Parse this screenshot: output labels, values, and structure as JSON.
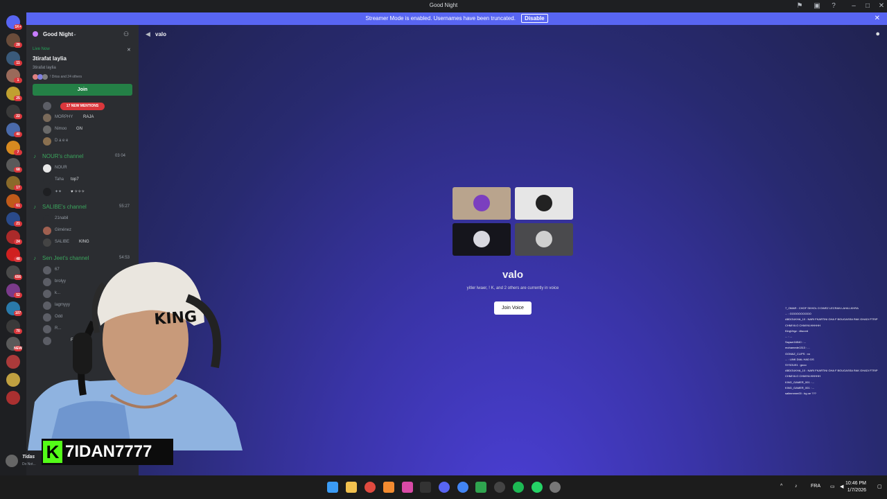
{
  "window": {
    "title": "Good Night"
  },
  "banner": {
    "text": "Streamer Mode is enabled. Usernames have been truncated.",
    "disable_label": "Disable"
  },
  "guilds": {
    "badges": [
      "1K+",
      "28",
      "11",
      "1",
      "25",
      "22",
      "40",
      "7",
      "68",
      "17",
      "61",
      "21",
      "24",
      "48",
      "656",
      "52",
      "107",
      "70",
      "NEW"
    ]
  },
  "server": {
    "name": "Good Night",
    "live": {
      "status": "Live Now",
      "title": "3tirafat laylia",
      "subtitle": "3tirafat laylia",
      "watchers": "! Driss and 24 others",
      "join_label": "Join"
    },
    "mentions_pill": "17 NEW MENTIONS",
    "top_members": [
      {
        "name": "MORPHY",
        "tag": "RAJA"
      },
      {
        "name": "Nimoo",
        "tag": "GN"
      },
      {
        "name": "D a e e",
        "tag": ""
      }
    ],
    "voice_channels": [
      {
        "name": "NOUR's channel",
        "meta": "03 04",
        "members": [
          {
            "name": "NOUR"
          },
          {
            "name": "Taha",
            "tag": "top7"
          },
          {
            "name": "✦✦",
            "tag": "♥ ✧✧✧"
          }
        ]
      },
      {
        "name": "SALIBE's channel",
        "meta": "55:27",
        "members": [
          {
            "name": "21nabil"
          },
          {
            "name": "Giménez"
          },
          {
            "name": "SALIBE",
            "tag": "KING"
          }
        ]
      },
      {
        "name": "Sen Jeet's channel",
        "meta": "54:53",
        "members": [
          {
            "name": "67"
          },
          {
            "name": "brolyy"
          },
          {
            "name": "k..."
          },
          {
            "name": "lagmyyy"
          },
          {
            "name": "Odd"
          },
          {
            "name": "R..."
          },
          {
            "name": "F1"
          }
        ]
      }
    ],
    "user": {
      "name": "Tidas",
      "status": "Do Not..."
    }
  },
  "channel": {
    "name": "valo",
    "stage_title": "valo",
    "stage_sub": "yitler lwaer, ! K, and 2 others are currently in voice",
    "join_voice_label": "Join Voice"
  },
  "stream_chat": [
    "7_OMAR : CHOF SKHOL O DWEZ LECRAN LAHA LKHRA",
    "... : GOOOOOOOOO",
    "ABDOUKHA_10 : NARI FKARTINI GHA F BOUGASSA RAK GHADI FTRIP",
    "CHMIYA O CHMIYA HHHHH",
    "KingVegz : discord",
    "... : ...",
    "Sayazr16540 : ...",
    "mohamede1313 : ...",
    "GOMAZ_CLIPS : xo",
    "... : LINK DIAL HAD DS",
    "SYSOU91 : gooo",
    "ABDOUKHA_10 : NARI FKARTINI GHA F BOUGASSA RAK GHADI FTRIP",
    "CHMIYA O CHMIYA HHHHH",
    "KING_GAMER_001 : ...",
    "KING_GAMER_001 : ...",
    "salimmmm00 : bg oe ???"
  ],
  "webcam": {
    "handle": "7IDAN7777",
    "platform_icon": "K"
  },
  "taskbar": {
    "language": "FRA",
    "time": "10:46 PM",
    "date": "1/7/2026"
  },
  "colors": {
    "accent": "#5865f2",
    "green": "#23a559",
    "mention": "#da373c",
    "kick": "#53fc18"
  }
}
